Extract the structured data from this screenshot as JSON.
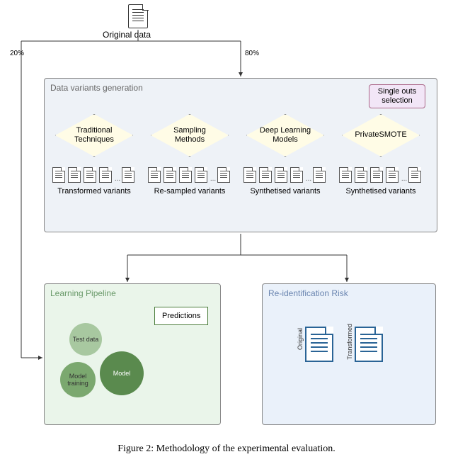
{
  "origin": {
    "label": "Original data",
    "split_left": "20%",
    "split_right": "80%"
  },
  "generation": {
    "title": "Data variants generation",
    "single_outs": "Single outs selection",
    "methods": [
      {
        "name": "Traditional Techniques",
        "output": "Transformed variants"
      },
      {
        "name": "Sampling Methods",
        "output": "Re-sampled variants"
      },
      {
        "name": "Deep Learning Models",
        "output": "Synthetised variants"
      },
      {
        "name": "PrivateSMOTE",
        "output": "Synthetised variants"
      }
    ]
  },
  "learning": {
    "title": "Learning Pipeline",
    "gear_test": "Test data",
    "gear_train": "Model training",
    "gear_model": "Model",
    "predictions": "Predictions"
  },
  "reid": {
    "title": "Re-identification Risk",
    "left_doc": "Original",
    "right_doc": "Transformed"
  },
  "caption": "Figure 2: Methodology of the experimental evaluation."
}
